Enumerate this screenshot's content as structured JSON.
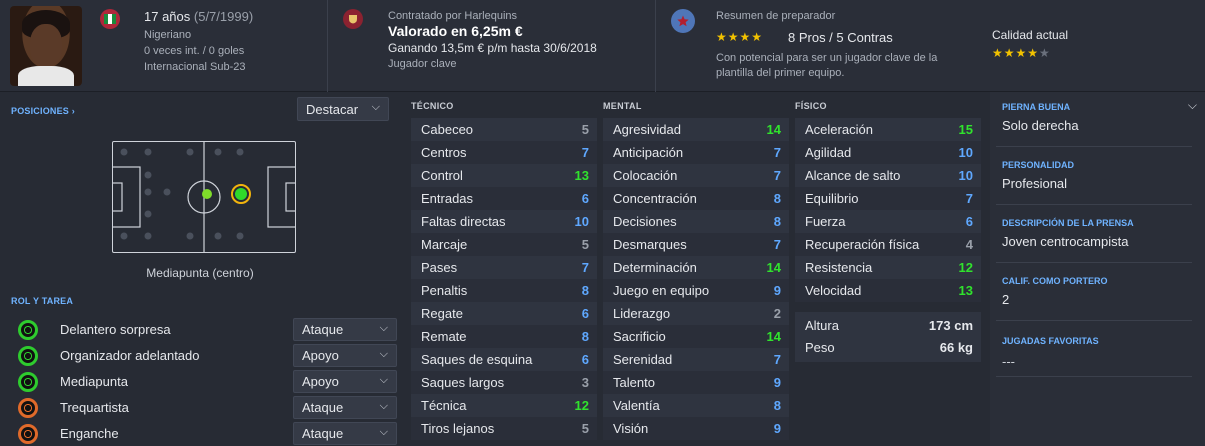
{
  "header": {
    "age": "17 años",
    "dob": "(5/7/1999)",
    "nationality": "Nigeriano",
    "caps": "0 veces int. / 0 goles",
    "intl_level": "Internacional Sub-23",
    "contract_label": "Contratado por Harlequins",
    "value": "Valorado en 6,25m €",
    "wage": "Ganando 13,5m € p/m hasta 30/6/2018",
    "squad_status": "Jugador clave",
    "coach_report_label": "Resumen de preparador",
    "pros_cons": "8 Pros / 5 Contras",
    "report_text_1": "Con potencial para ser un jugador clave de la",
    "report_text_2": "plantilla del primer equipo.",
    "current_ability_label": "Calidad actual",
    "report_stars": 4,
    "ability_stars": 4
  },
  "positions": {
    "title": "POSICIONES ›",
    "highlight_label": "Destacar",
    "position_name": "Mediapunta (centro)"
  },
  "roles": {
    "title": "ROL Y TAREA",
    "items": [
      {
        "name": "Delantero sorpresa",
        "duty": "Ataque",
        "color": "#2ecc2e"
      },
      {
        "name": "Organizador adelantado",
        "duty": "Apoyo",
        "color": "#2ecc2e"
      },
      {
        "name": "Mediapunta",
        "duty": "Apoyo",
        "color": "#2ecc2e"
      },
      {
        "name": "Trequartista",
        "duty": "Ataque",
        "color": "#e06a2a"
      },
      {
        "name": "Enganche",
        "duty": "Ataque",
        "color": "#e06a2a"
      }
    ]
  },
  "attributes": {
    "technical_title": "TÉCNICO",
    "mental_title": "MENTAL",
    "physical_title": "FÍSICO",
    "technical": [
      {
        "name": "Cabeceo",
        "value": "5"
      },
      {
        "name": "Centros",
        "value": "7"
      },
      {
        "name": "Control",
        "value": "13"
      },
      {
        "name": "Entradas",
        "value": "6"
      },
      {
        "name": "Faltas directas",
        "value": "10"
      },
      {
        "name": "Marcaje",
        "value": "5"
      },
      {
        "name": "Pases",
        "value": "7"
      },
      {
        "name": "Penaltis",
        "value": "8"
      },
      {
        "name": "Regate",
        "value": "6"
      },
      {
        "name": "Remate",
        "value": "8"
      },
      {
        "name": "Saques de esquina",
        "value": "6"
      },
      {
        "name": "Saques largos",
        "value": "3"
      },
      {
        "name": "Técnica",
        "value": "12"
      },
      {
        "name": "Tiros lejanos",
        "value": "5"
      }
    ],
    "mental": [
      {
        "name": "Agresividad",
        "value": "14"
      },
      {
        "name": "Anticipación",
        "value": "7"
      },
      {
        "name": "Colocación",
        "value": "7"
      },
      {
        "name": "Concentración",
        "value": "8"
      },
      {
        "name": "Decisiones",
        "value": "8"
      },
      {
        "name": "Desmarques",
        "value": "7"
      },
      {
        "name": "Determinación",
        "value": "14"
      },
      {
        "name": "Juego en equipo",
        "value": "9"
      },
      {
        "name": "Liderazgo",
        "value": "2"
      },
      {
        "name": "Sacrificio",
        "value": "14"
      },
      {
        "name": "Serenidad",
        "value": "7"
      },
      {
        "name": "Talento",
        "value": "9"
      },
      {
        "name": "Valentía",
        "value": "8"
      },
      {
        "name": "Visión",
        "value": "9"
      }
    ],
    "physical": [
      {
        "name": "Aceleración",
        "value": "15"
      },
      {
        "name": "Agilidad",
        "value": "10"
      },
      {
        "name": "Alcance de salto",
        "value": "10"
      },
      {
        "name": "Equilibrio",
        "value": "7"
      },
      {
        "name": "Fuerza",
        "value": "6"
      },
      {
        "name": "Recuperación física",
        "value": "4"
      },
      {
        "name": "Resistencia",
        "value": "12"
      },
      {
        "name": "Velocidad",
        "value": "13"
      }
    ],
    "height_label": "Altura",
    "height_value": "173 cm",
    "weight_label": "Peso",
    "weight_value": "66 kg"
  },
  "info": {
    "foot_title": "PIERNA BUENA",
    "foot_value": "Solo derecha",
    "personality_title": "PERSONALIDAD",
    "personality_value": "Profesional",
    "press_title": "DESCRIPCIÓN DE LA PRENSA",
    "press_value": "Joven centrocampista",
    "gk_title": "CALIF. COMO PORTERO",
    "gk_value": "2",
    "traits_title": "JUGADAS FAVORITAS",
    "traits_value": "---"
  },
  "colors": {
    "high": "#30e32d",
    "mid": "#5fa8ff",
    "low": "#9aa0aa",
    "accent": "#6fb3ff"
  }
}
